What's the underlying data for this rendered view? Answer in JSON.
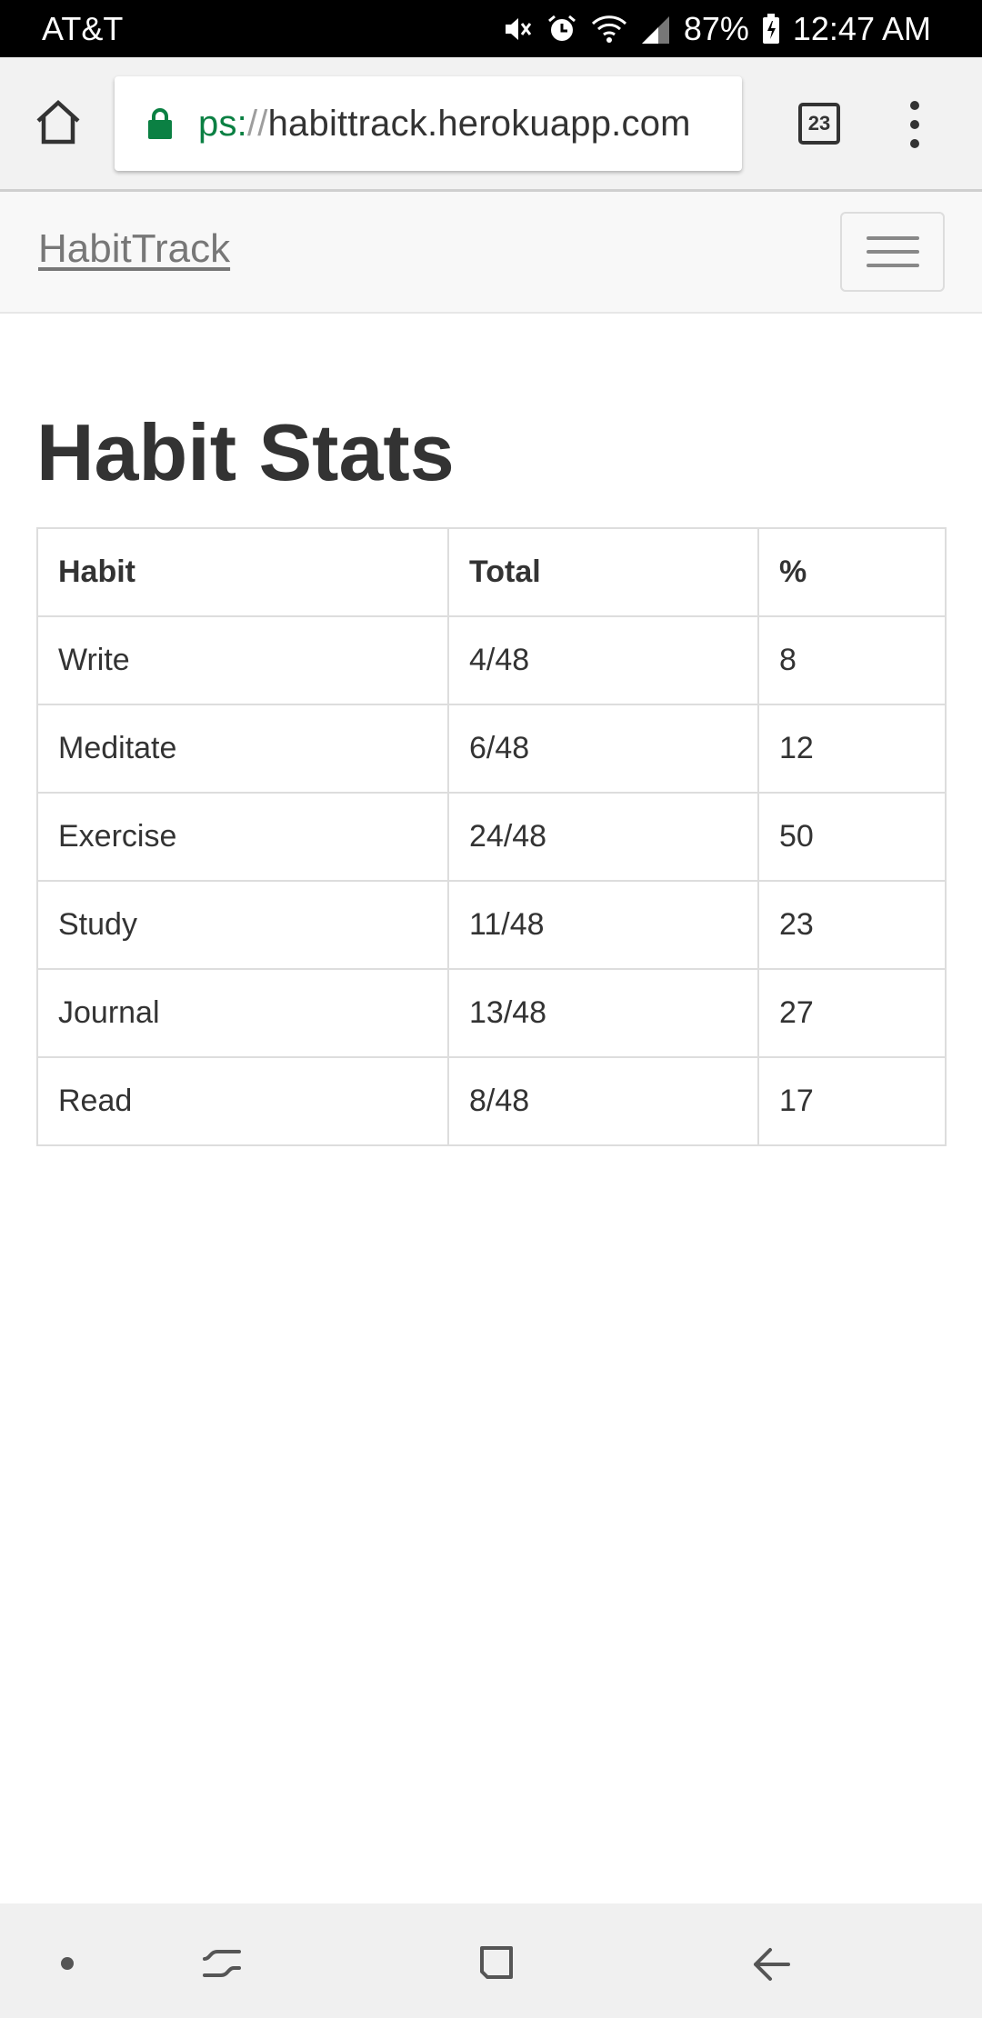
{
  "status_bar": {
    "carrier": "AT&T",
    "battery": "87%",
    "time": "12:47 AM"
  },
  "browser": {
    "url_scheme": "ps:",
    "url_separator": "//",
    "url_host": "habittrack.herokuapp.com",
    "tab_count": "23",
    "secure_color": "#0b8043"
  },
  "site": {
    "brand": "HabitTrack"
  },
  "page": {
    "title": "Habit Stats"
  },
  "table": {
    "headers": [
      "Habit",
      "Total",
      "%"
    ],
    "rows": [
      [
        "Write",
        "4/48",
        "8"
      ],
      [
        "Meditate",
        "6/48",
        "12"
      ],
      [
        "Exercise",
        "24/48",
        "50"
      ],
      [
        "Study",
        "11/48",
        "23"
      ],
      [
        "Journal",
        "13/48",
        "27"
      ],
      [
        "Read",
        "8/48",
        "17"
      ]
    ]
  }
}
